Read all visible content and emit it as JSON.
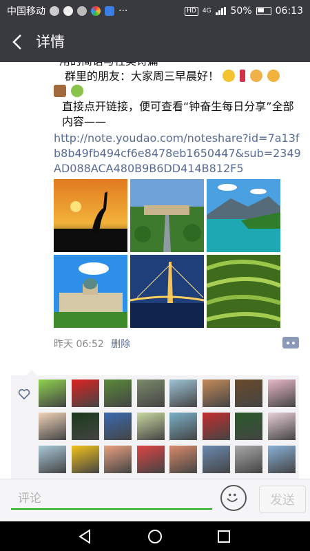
{
  "status_bar": {
    "carrier": "中国移动",
    "more_dots": "···",
    "hd": "HD",
    "network": "4G",
    "battery": "50%",
    "time": "06:13"
  },
  "header": {
    "title": "详情"
  },
  "post": {
    "line_partial": "用的简语与社美诗篇",
    "greeting": "群里的朋友：大家周三早晨好！",
    "instruction": "直接点开链接，便可查看“钟奋生每日分享”全部内容——",
    "link": "http://note.youdao.com/noteshare?id=7a13fb8b49fb494cf6e8478eb1650447&sub=2349AD088ACA480B9B6DD414B812F5",
    "timestamp": "昨天 06:52",
    "delete_label": "删除"
  },
  "likes": {
    "avatar_count": 24
  },
  "comment_bar": {
    "placeholder": "评论",
    "send_label": "发送"
  },
  "colors": {
    "header_bg": "#393a3f",
    "link": "#576b95",
    "accent_green": "#1aad19"
  },
  "icons": [
    "back-arrow-icon",
    "heart-icon",
    "more-dots-icon",
    "emoji-icon",
    "nav-back-icon",
    "nav-home-icon",
    "nav-recents-icon"
  ]
}
